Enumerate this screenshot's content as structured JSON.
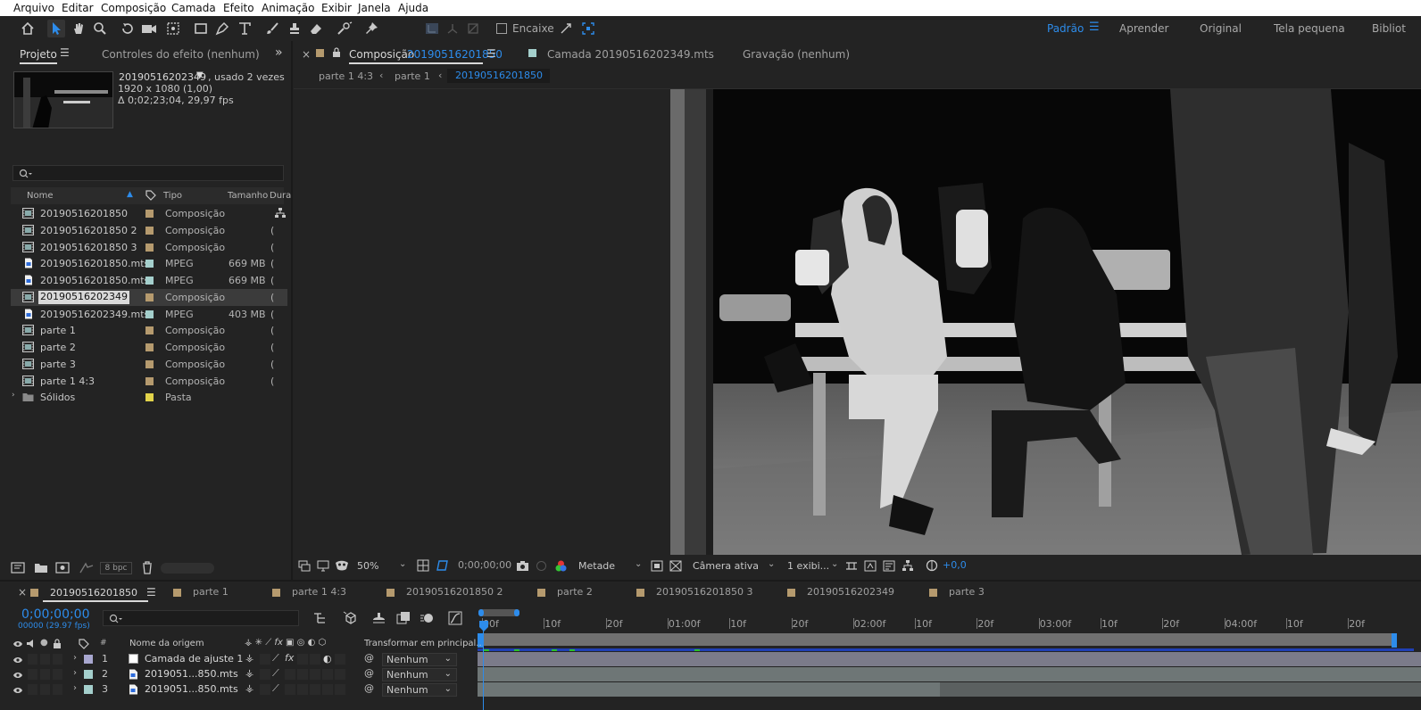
{
  "menu": [
    "Arquivo",
    "Editar",
    "Composição",
    "Camada",
    "Efeito",
    "Animação",
    "Exibir",
    "Janela",
    "Ajuda"
  ],
  "toolbar": {
    "snapping_label": "Encaixe",
    "workspaces": [
      "Padrão",
      "Aprender",
      "Original",
      "Tela pequena",
      "Bibliot"
    ],
    "active_workspace": "Padrão"
  },
  "project_panel": {
    "tab_label": "Projeto",
    "effect_controls_label": "Controles do efeito (nenhum)",
    "selected_item": {
      "name": "20190516202349",
      "usage": ", usado 2 vezes",
      "resolution": "1920 x 1080 (1,00)",
      "duration": "Δ 0;02;23;04, 29,97 fps"
    },
    "columns": [
      "Nome",
      "Tipo",
      "Tamanho",
      "Dura"
    ],
    "items": [
      {
        "name": "20190516201850",
        "type": "Composição",
        "size": "",
        "kind": "comp",
        "label_color": "#b59a6e"
      },
      {
        "name": "20190516201850 2",
        "type": "Composição",
        "size": "",
        "kind": "comp",
        "label_color": "#b59a6e"
      },
      {
        "name": "20190516201850 3",
        "type": "Composição",
        "size": "",
        "kind": "comp",
        "label_color": "#b59a6e"
      },
      {
        "name": "20190516201850.mts",
        "type": "MPEG",
        "size": "669 MB",
        "kind": "file",
        "label_color": "#a4cfcc"
      },
      {
        "name": "20190516201850.mts",
        "type": "MPEG",
        "size": "669 MB",
        "kind": "file",
        "label_color": "#a4cfcc"
      },
      {
        "name": "20190516202349",
        "type": "Composição",
        "size": "",
        "kind": "comp",
        "label_color": "#b59a6e",
        "selected": true
      },
      {
        "name": "20190516202349.mts",
        "type": "MPEG",
        "size": "403 MB",
        "kind": "file",
        "label_color": "#a4cfcc"
      },
      {
        "name": "parte 1",
        "type": "Composição",
        "size": "",
        "kind": "comp",
        "label_color": "#b59a6e"
      },
      {
        "name": "parte 2",
        "type": "Composição",
        "size": "",
        "kind": "comp",
        "label_color": "#b59a6e"
      },
      {
        "name": "parte 3",
        "type": "Composição",
        "size": "",
        "kind": "comp",
        "label_color": "#b59a6e"
      },
      {
        "name": "parte 1 4:3",
        "type": "Composição",
        "size": "",
        "kind": "comp",
        "label_color": "#b59a6e"
      },
      {
        "name": "Sólidos",
        "type": "Pasta",
        "size": "",
        "kind": "folder",
        "label_color": "#e2d34a"
      }
    ],
    "bpc_label": "8 bpc"
  },
  "composition_panel": {
    "tab_prefix": "Composição",
    "tab_name": "20190516201850",
    "layer_tab": "Camada 20190516202349.mts",
    "footage_tab": "Gravação (nenhum)",
    "breadcrumbs": [
      "parte 1 4:3",
      "parte 1",
      "20190516201850"
    ],
    "zoom": "50%",
    "timecode": "0;00;00;00",
    "resolution": "Metade",
    "camera": "Câmera ativa",
    "views": "1 exibi...",
    "exposure": "+0,0"
  },
  "timeline": {
    "tabs": [
      {
        "name": "20190516201850",
        "active": true
      },
      {
        "name": "parte 1"
      },
      {
        "name": "parte 1 4:3"
      },
      {
        "name": "20190516201850 2"
      },
      {
        "name": "parte 2"
      },
      {
        "name": "20190516201850 3"
      },
      {
        "name": "20190516202349"
      },
      {
        "name": "parte 3"
      }
    ],
    "current_time": "0;00;00;00",
    "frame_info": "00000 (29.97 fps)",
    "ruler": [
      "00f",
      "10f",
      "20f",
      "01:00f",
      "10f",
      "20f",
      "02:00f",
      "10f",
      "20f",
      "03:00f",
      "10f",
      "20f",
      "04:00f",
      "10f",
      "20f"
    ],
    "col_source": "Nome da origem",
    "col_mode": "Transformar em principal...",
    "layers": [
      {
        "num": "1",
        "name": "Camada de ajuste 1",
        "parent": "Nenhum",
        "label_color": "#a8a7cf",
        "kind": "adjust"
      },
      {
        "num": "2",
        "name": "2019051...850.mts",
        "parent": "Nenhum",
        "label_color": "#a4cfcc",
        "kind": "file"
      },
      {
        "num": "3",
        "name": "2019051...850.mts",
        "parent": "Nenhum",
        "label_color": "#a4cfcc",
        "kind": "file"
      }
    ],
    "colors": {
      "accent": "#2d8ceb",
      "track": "#6e7676",
      "track_adjust": "#7b7b8a",
      "work_area": "#707070"
    }
  }
}
